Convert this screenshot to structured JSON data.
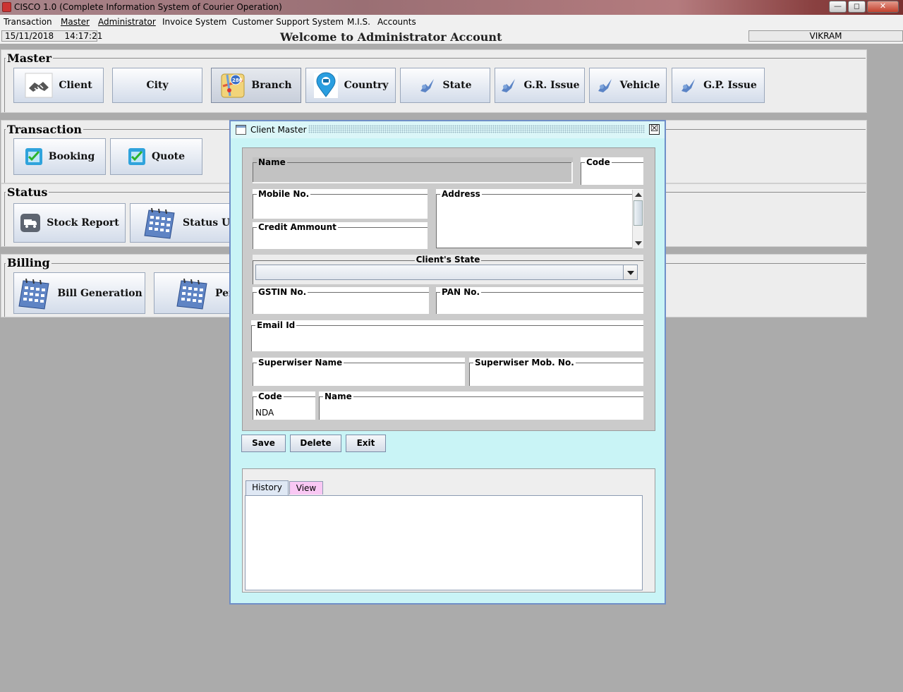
{
  "app": {
    "title": "CISCO 1.0 (Complete Information System of Courier Operation)",
    "window_controls": {
      "minimize": "—",
      "restore": "◻",
      "close": "✕"
    }
  },
  "menu": [
    "Transaction",
    "Master",
    "Administrator",
    "Invoice System",
    "Customer Support System",
    "M.I.S.",
    "Accounts"
  ],
  "status": {
    "date": "15/11/2018",
    "time": "14:17:21",
    "user": "VIKRAM"
  },
  "welcome": "Welcome to Administrator Account",
  "sections": {
    "master": {
      "legend": "Master",
      "tiles": [
        {
          "label": "Client",
          "icon": "handshake-icon"
        },
        {
          "label": "City",
          "icon": ""
        },
        {
          "label": "Branch",
          "icon": "map-icon"
        },
        {
          "label": "Country",
          "icon": "location-pin-icon"
        },
        {
          "label": "State",
          "icon": "bird-icon"
        },
        {
          "label": "G.R. Issue",
          "icon": "bird-icon"
        },
        {
          "label": "Vehicle",
          "icon": "bird-icon"
        },
        {
          "label": "G.P. Issue",
          "icon": "bird-icon"
        }
      ]
    },
    "transaction": {
      "legend": "Transaction",
      "tiles": [
        {
          "label": "Booking",
          "icon": "checklist-icon"
        },
        {
          "label": "Quote",
          "icon": "checklist-icon"
        }
      ]
    },
    "status": {
      "legend": "Status",
      "tiles": [
        {
          "label": "Stock Report",
          "icon": "truck-icon"
        },
        {
          "label": "Status Upda",
          "icon": "calendar-icon"
        }
      ]
    },
    "billing": {
      "legend": "Billing",
      "tiles": [
        {
          "label": "Bill Generation",
          "icon": "calendar-icon"
        },
        {
          "label": "Pen",
          "icon": "calendar-icon"
        }
      ]
    }
  },
  "dialog": {
    "title": "Client Master",
    "close": "☒",
    "fields": {
      "name": {
        "label": "Name",
        "value": ""
      },
      "code": {
        "label": "Code",
        "value": ""
      },
      "mobile": {
        "label": "Mobile No.",
        "value": ""
      },
      "address": {
        "label": "Address",
        "value": ""
      },
      "credit": {
        "label": "Credit Ammount",
        "value": ""
      },
      "state": {
        "label": "Client's State",
        "value": ""
      },
      "gstin": {
        "label": "GSTIN No.",
        "value": ""
      },
      "pan": {
        "label": "PAN No.",
        "value": ""
      },
      "email": {
        "label": "Email Id",
        "value": ""
      },
      "sup_name": {
        "label": "Superwiser Name",
        "value": ""
      },
      "sup_mob": {
        "label": "Superwiser Mob. No.",
        "value": ""
      },
      "branch_code": {
        "label": "Code",
        "value": "NDA"
      },
      "branch_name": {
        "label": "Name",
        "value": ""
      }
    },
    "buttons": {
      "save": "Save",
      "delete": "Delete",
      "exit": "Exit"
    },
    "tabs": [
      "History",
      "View"
    ],
    "colors": {
      "dialog_bg": "#c9f4f6",
      "view_tab": "#f9c8f4",
      "history_tab": "#dfe8f4"
    }
  }
}
